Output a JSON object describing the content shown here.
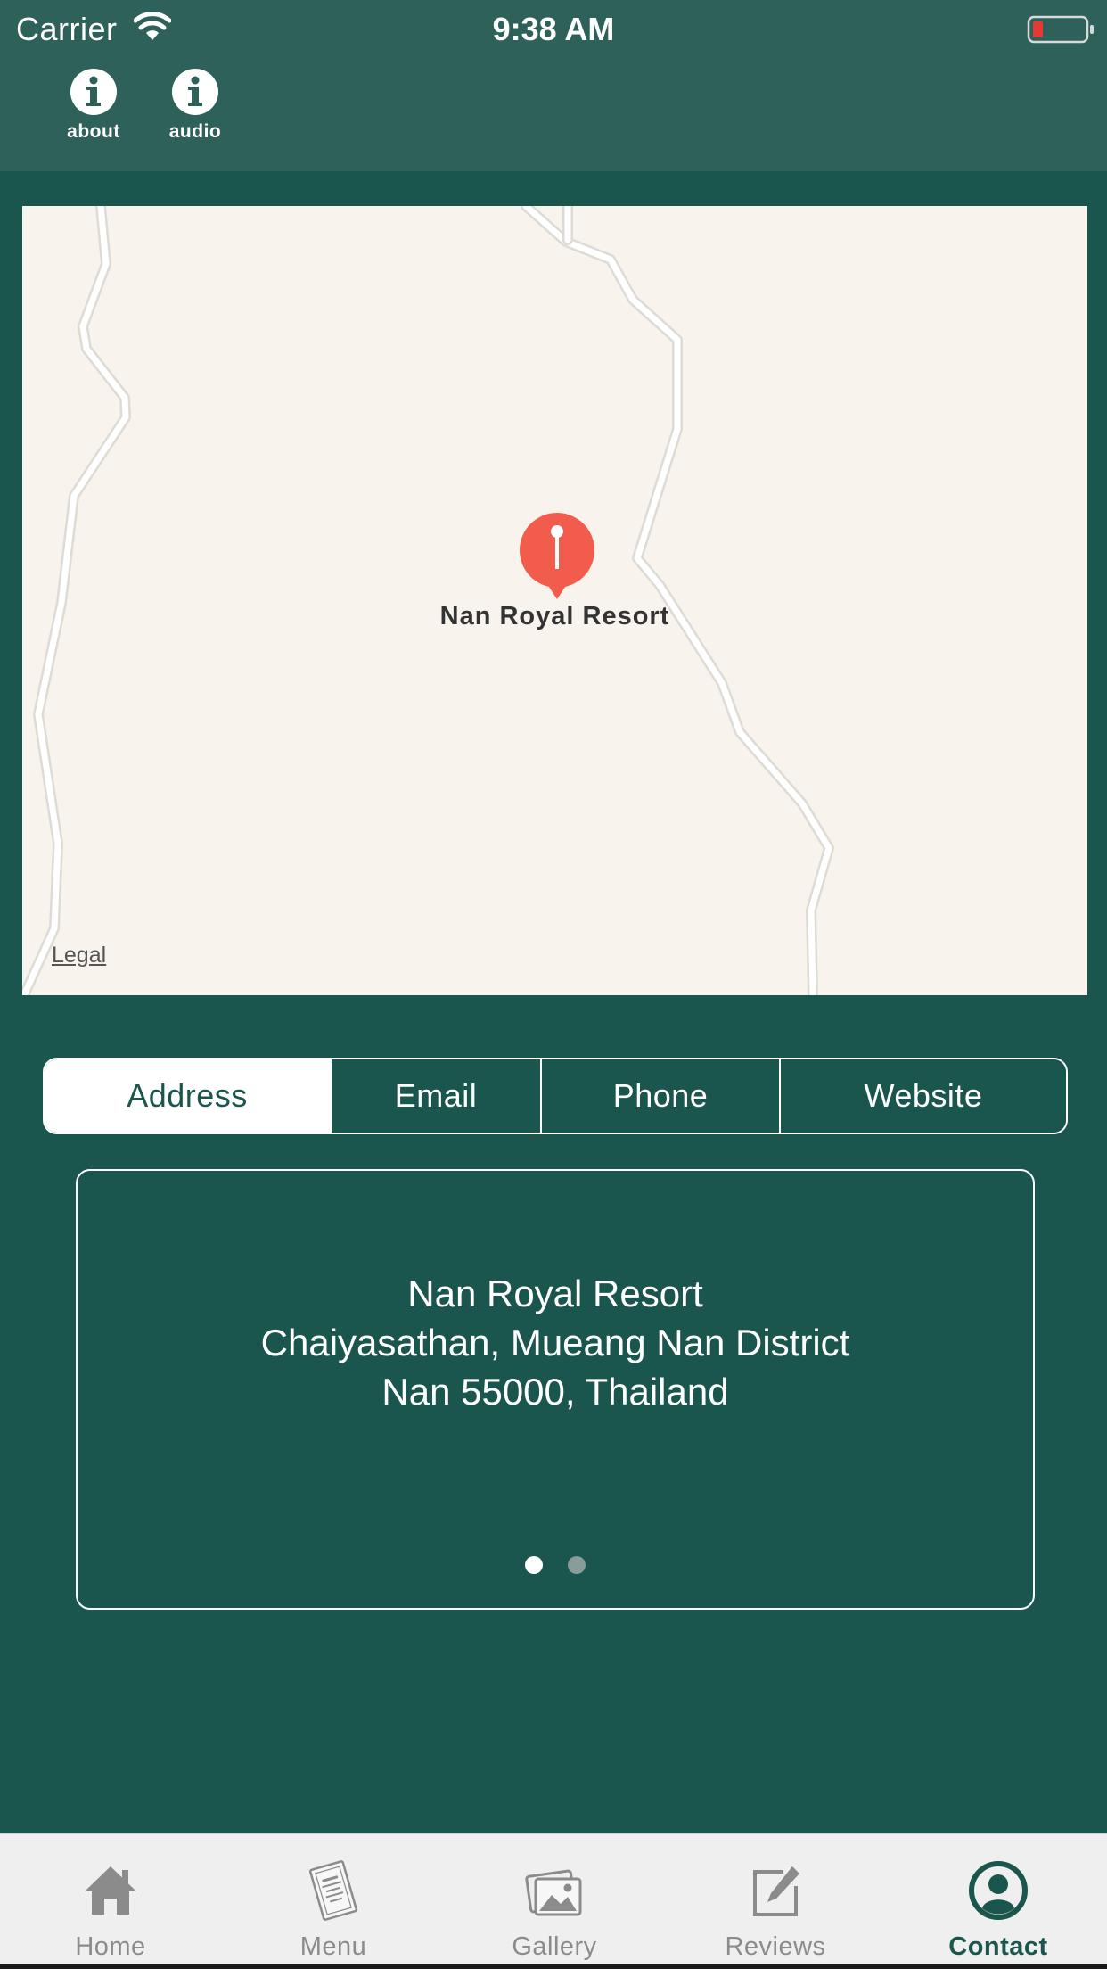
{
  "status_bar": {
    "carrier": "Carrier",
    "time": "9:38 AM",
    "battery_color": "#e53935"
  },
  "nav": {
    "items": [
      {
        "label": "about",
        "icon": "info-icon"
      },
      {
        "label": "audio",
        "icon": "info-icon"
      }
    ]
  },
  "map": {
    "pin_label": "Nan Royal Resort",
    "legal_label": "Legal",
    "pin_color": "#f25c4d",
    "background": "#f8f4ed"
  },
  "segments": {
    "active": "Address",
    "items": [
      "Address",
      "Email",
      "Phone",
      "Website"
    ]
  },
  "address_card": {
    "lines": [
      "Nan Royal Resort",
      "Chaiyasathan, Mueang Nan District",
      "Nan 55000, Thailand"
    ],
    "pages": 2,
    "current_page": 1
  },
  "tabbar": {
    "active": "Contact",
    "items": [
      {
        "label": "Home",
        "icon": "home-icon"
      },
      {
        "label": "Menu",
        "icon": "menu-card-icon"
      },
      {
        "label": "Gallery",
        "icon": "gallery-icon"
      },
      {
        "label": "Reviews",
        "icon": "edit-icon"
      },
      {
        "label": "Contact",
        "icon": "contact-icon"
      }
    ]
  },
  "colors": {
    "primary": "#1a564e",
    "header": "#2d6159",
    "tab_inactive": "#8b8b8b"
  }
}
